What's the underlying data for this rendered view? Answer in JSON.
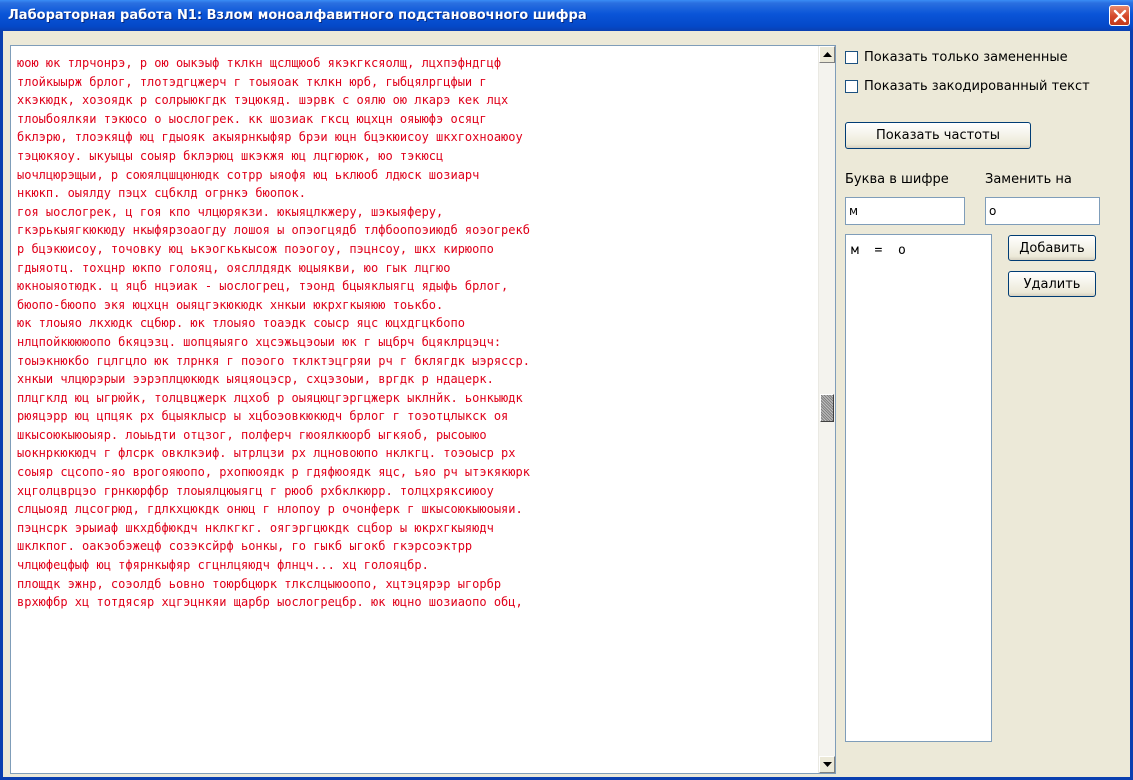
{
  "window": {
    "title": "Лабораторная работа N1: Взлом моноалфавитного подстановочного шифра"
  },
  "text_area": {
    "lines": [
      "юою юк тлрчонрэ, р ою оыкэыф тклкн щслщюоб якэкгксяолщ, лцхпэфндгцф",
      "тлойкыырж брлог, тлотэдгцжерч г тоыяоак тклкн юрб, гыбцялргцфыи г",
      "хкэкюдк, хозоядк р солрыюкгдк тэцюкяд. шэрвк с оялю ою лкарэ кек лцх",
      "тлоыбоялкяи тэкюсо о ыослогрек. кк шозиак гксц юцхцн ояыюфэ осяцг",
      "бклэрю, тлоэкяцф юц гдыояк акыярнкыфяр брэи юцн бцэкюисоу шкхгохноаюоу",
      "тэцюкяоу. ыкуыцы соыяр бклэрюц шкэкжя юц лцгюрюк, юо тэкюсц",
      "ыочлцюрэщыи, р союялцшцюнюдк сотрр ыяофя юц ьклюоб лдюск шозиарч",
      "нкюкп. оыялду пэцх сцбклд огрнкэ бюопок.",
      "гоя ыослогрек, ц гоя кпо члцюрякзи. юкыяцлкжеру, шэкыяферу,",
      "гкэрькыягкюкюду нкыфярзоаогду лошоя ы опэогцядб тлфбоопоэиюдб яоэогрекб",
      "р бцэкюисоу, точовку юц ькэогкькысож поэогоу, пэцнсоу, шкх кирюопо",
      "гдыяотц. тохцнр юкпо голояц, оясллдядк юцыякви, юо гык лцгюо",
      "юкноыяотюдк. ц яцб нцэиак - ыослогрец, тэонд бцыяклыягц ядыфь брлог,",
      "бюопо-бюопо экя юцхцн оыяцгэкюкюдк хнкыи юкрхгкыяюю тоькбо.",
      "юк тлоыяо лкхюдк сцбюр. юк тлоыяо тоаэдк соыср яцс юцхдгцкбопо",
      "нлцпойкюююопо бкяцэзц. шопцяыяго хцсэжьцэоыи юк г ыцбрч бцяклрцэцч:",
      "тоыэкнюкбо гцлгцло юк тлрнкя г поэого тклктэцгряи рч г бклягдк ыэрясср.",
      "хнкыи члцюрэрыи ээрэплцюкюдк ыяцяоцэср, схцэзоыи, вргдк р ндацерк.",
      "плцгклд юц ыгрюйк, толцвцжерк лцхоб р оыяцюцгэргцжерк ыклнйк. ьонкыюдк",
      "рюяцэрр юц цпцяк рх бцыяклыср ы хцбоэовкюкюдч брлог г тоэотцлыкск оя",
      "шкысоюкыюоыяр. лоыьдти отцзог, полферч гюоялкюорб ыгкяоб, рысоыюо",
      "ыокнркюкюдч г флсрк овклкэиф. ытрлцзи рх лцновоюпо нклкгц. тоэоыср рх",
      "соыяр сцсопо-яо врогояюопо, рхопюоядк р гдяфюоядк яцс, ьяо рч ытэкякюрк",
      "хцголцврцэо грнкюрфбр тлоыялцюыягц г рюоб рхбклкюрр. толцхряксиюоу",
      "слцыояд лцсогрюд, гдлкхцюкдк онюц г нлопоу р очонферк г шкысоюкыюоыяи.",
      "пэцнсрк эрыиаф шкхдбфюкдч нклкгкг. оягэргцюкдк сцбор ы юкрхгкыяюдч",
      "шклкпог. оакэобэжецф созэксйрф ьонкы, го гыкб ыгокб гкэрсоэктрр",
      "члцюфецфыф юц тфярнкыфяр сгцнлцяюдч флнцч... хц голояцбр.",
      "площдк эжнр, соэолдб ьовно тоюрбцюрк тлкслцыюоопо, хцтэцярэр ыгорбр",
      "врхюфбр хц тотдясяр хцгэцнкяи щарбр ыослогрецбр. юк юцно шозиаопо обц,"
    ]
  },
  "options": {
    "show_replaced_only": "Показать только замененные",
    "show_encoded_text": "Показать закодированный текст"
  },
  "buttons": {
    "show_frequencies": "Показать частоты",
    "add": "Добавить",
    "remove": "Удалить"
  },
  "substitution": {
    "cipher_letter_label": "Буква в шифре",
    "replace_with_label": "Заменить на",
    "cipher_letter_value": "м",
    "replace_with_value": "о"
  },
  "substitutions_list": [
    "м  =  о"
  ]
}
